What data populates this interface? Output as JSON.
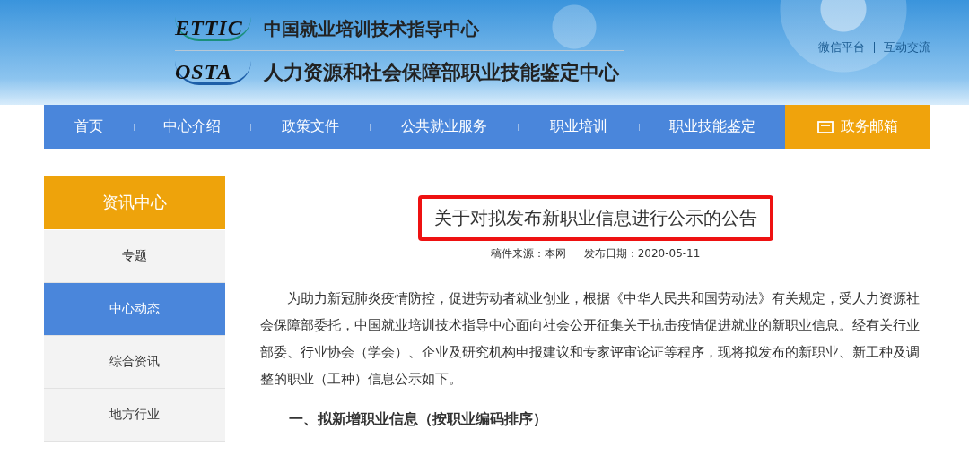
{
  "header": {
    "logos": [
      {
        "mark": "ETTIC",
        "name": "中国就业培训技术指导中心"
      },
      {
        "mark": "OSTA",
        "name": "人力资源和社会保障部职业技能鉴定中心"
      }
    ],
    "links": [
      "微信平台",
      "互动交流"
    ]
  },
  "nav": [
    {
      "label": "首页",
      "kind": "link"
    },
    {
      "label": "中心介绍",
      "kind": "link"
    },
    {
      "label": "政策文件",
      "kind": "link"
    },
    {
      "label": "公共就业服务",
      "kind": "link"
    },
    {
      "label": "职业培训",
      "kind": "link"
    },
    {
      "label": "职业技能鉴定",
      "kind": "link"
    },
    {
      "label": "政务邮箱",
      "kind": "mailbox"
    }
  ],
  "sidebar": {
    "title": "资讯中心",
    "items": [
      {
        "label": "专题",
        "selected": false
      },
      {
        "label": "中心动态",
        "selected": true
      },
      {
        "label": "综合资讯",
        "selected": false
      },
      {
        "label": "地方行业",
        "selected": false
      }
    ]
  },
  "article": {
    "title": "关于对拟发布新职业信息进行公示的公告",
    "highlighted": true,
    "meta": [
      "稿件来源：本网",
      "发布日期：2020-05-11"
    ],
    "paragraph": "为助力新冠肺炎疫情防控，促进劳动者就业创业，根据《中华人民共和国劳动法》有关规定，受人力资源社会保障部委托，中国就业培训技术指导中心面向社会公开征集关于抗击疫情促进就业的新职业信息。经有关行业部委、行业协会（学会）、企业及研究机构申报建议和专家评审论证等程序，现将拟发布的新职业、新工种及调整的职业（工种）信息公示如下。",
    "heading": "一、拟新增职业信息（按职业编码排序）"
  }
}
